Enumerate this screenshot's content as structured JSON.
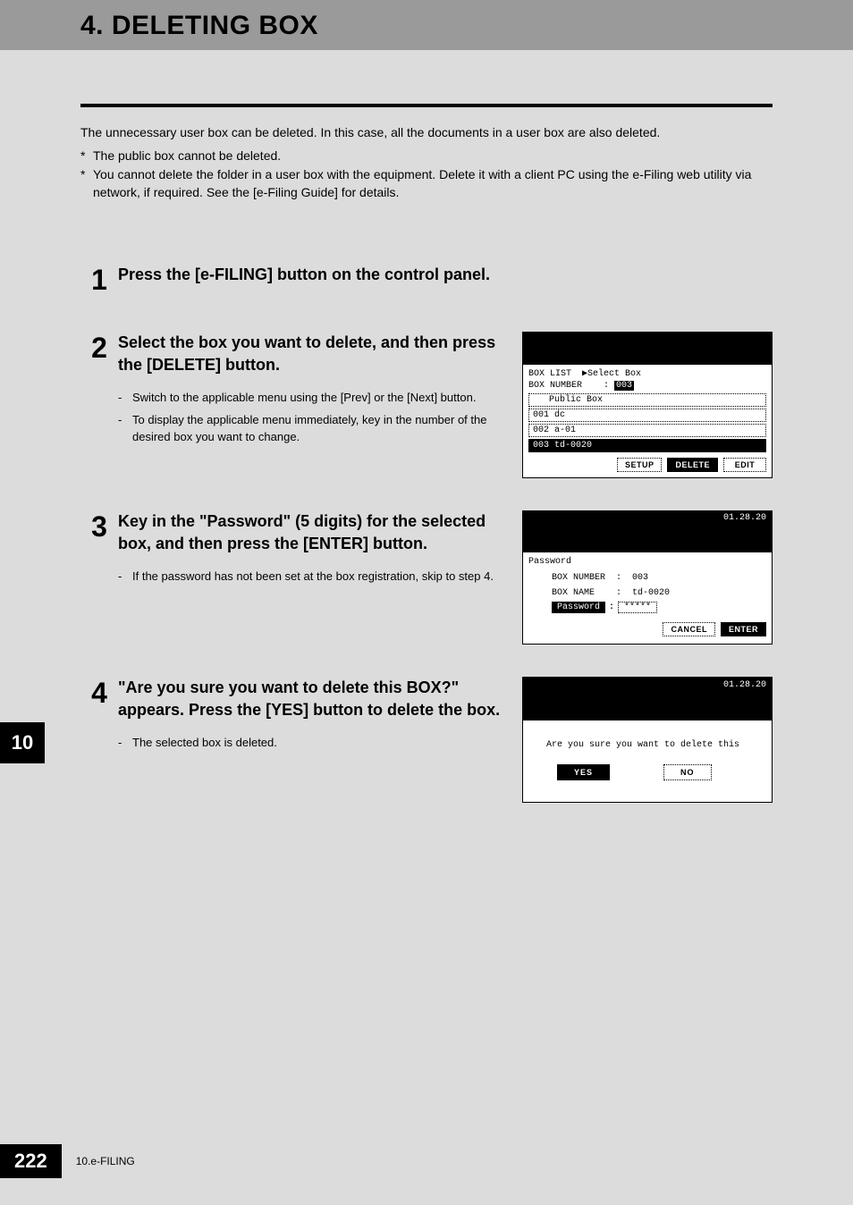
{
  "header": {
    "title": "4. DELETING BOX"
  },
  "intro": {
    "main": "The unnecessary user box can be deleted. In this case, all the documents in a user box are also deleted.",
    "note1": "The public box cannot be deleted.",
    "note2": "You cannot delete the folder in a user box with the equipment. Delete it with a client PC using the e-Filing web utility via network, if required. See the [e-Filing Guide] for details."
  },
  "steps": {
    "s1": {
      "num": "1",
      "title": "Press the [e-FILING] button on the control panel."
    },
    "s2": {
      "num": "2",
      "title": "Select the box you want to delete, and then press the [DELETE] button.",
      "b1": "Switch to the applicable menu using the [Prev] or the [Next] button.",
      "b2": "To display the applicable menu immediately, key in the number of the desired box you want to change."
    },
    "s3": {
      "num": "3",
      "title": "Key in the \"Password\" (5 digits) for the selected box, and then press the [ENTER] button.",
      "b1": "If the password has not been set at the box registration, skip to step 4."
    },
    "s4": {
      "num": "4",
      "title": "\"Are you sure you want to delete this BOX?\" appears. Press the [YES] button to delete the box.",
      "b1": "The selected box is deleted."
    }
  },
  "lcd1": {
    "top1": "BOX LIST  ▶Select Box",
    "top2_label": "BOX NUMBER    :",
    "top2_value": "003",
    "row0": "   Public Box",
    "row1": "001 dc",
    "row2": "002 a-01",
    "row3": "003 td-0020",
    "btn1": "SETUP",
    "btn2": "DELETE",
    "btn3": "EDIT"
  },
  "lcd2": {
    "time": "01.28.20",
    "heading": "Password",
    "line1": "BOX NUMBER  :  003",
    "line2": "BOX NAME    :  td-0020",
    "pwd_label": "Password",
    "pwd_sep": ":",
    "pwd_val": "*****",
    "btn1": "CANCEL",
    "btn2": "ENTER"
  },
  "lcd3": {
    "time": "01.28.20",
    "text": "Are you sure you want to delete this",
    "yes": "YES",
    "no": "NO"
  },
  "side_tab": "10",
  "footer": {
    "page": "222",
    "section": "10.e-FILING"
  }
}
